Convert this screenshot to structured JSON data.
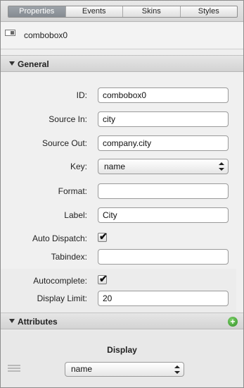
{
  "tabs": [
    "Properties",
    "Events",
    "Skins",
    "Styles"
  ],
  "active_tab": "Properties",
  "object": {
    "name": "combobox0",
    "icon": "combobox-icon"
  },
  "sections": {
    "general": "General",
    "attributes": "Attributes"
  },
  "fields": {
    "id": {
      "label": "ID:",
      "value": "combobox0"
    },
    "source_in": {
      "label": "Source In:",
      "value": "city"
    },
    "source_out": {
      "label": "Source Out:",
      "value": "company.city"
    },
    "key": {
      "label": "Key:",
      "value": "name"
    },
    "format": {
      "label": "Format:",
      "value": ""
    },
    "label": {
      "label": "Label:",
      "value": "City"
    },
    "auto_dispatch": {
      "label": "Auto Dispatch:",
      "checked": true
    },
    "tabindex": {
      "label": "Tabindex:",
      "value": ""
    },
    "autocomplete": {
      "label": "Autocomplete:",
      "checked": true
    },
    "display_limit": {
      "label": "Display Limit:",
      "value": "20"
    }
  },
  "attributes": {
    "display_title": "Display",
    "display_value": "name"
  },
  "checkmark": "✔",
  "add_symbol": "+"
}
